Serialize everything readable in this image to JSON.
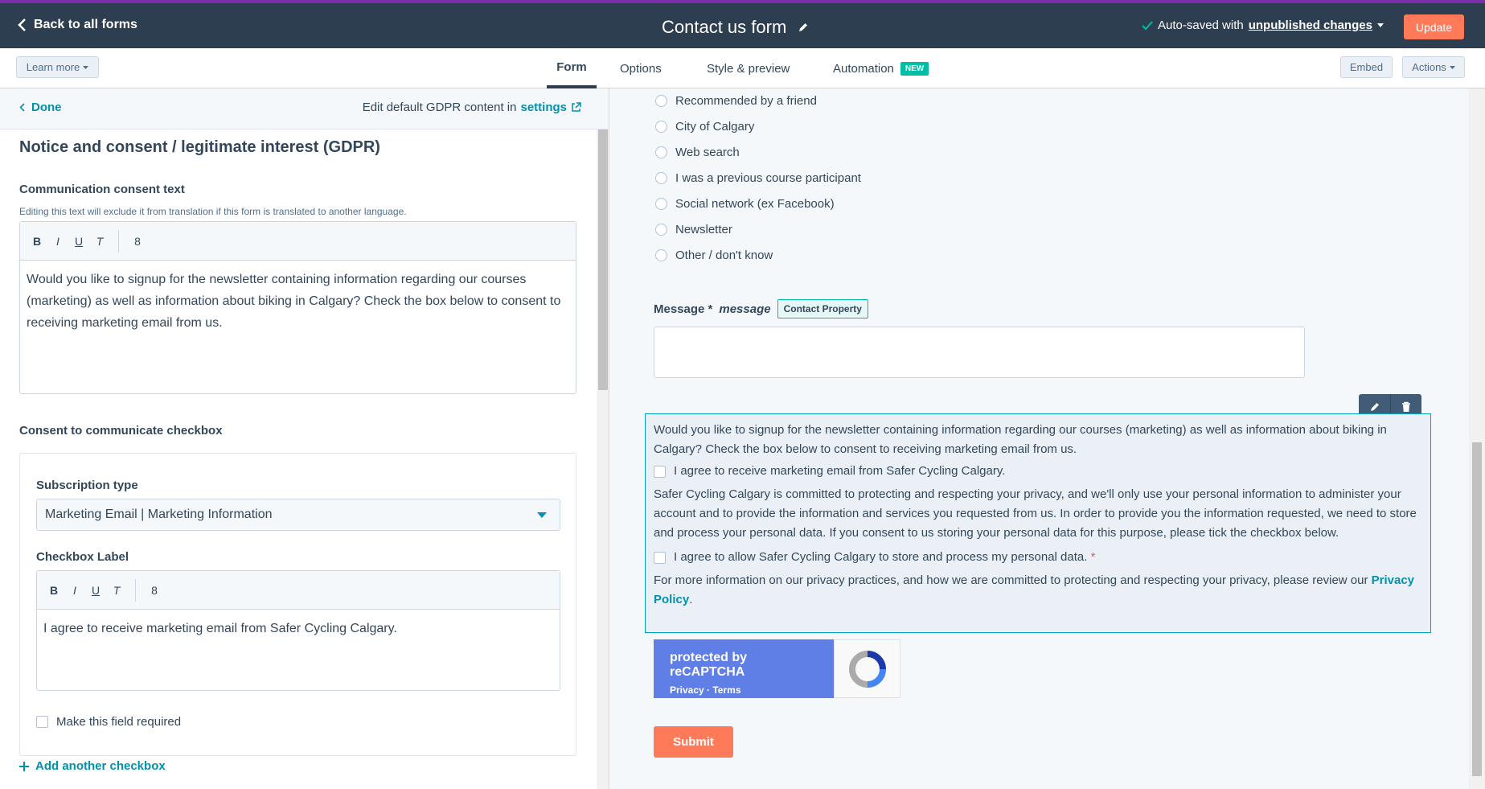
{
  "topbar": {
    "back_label": "Back to all forms",
    "form_title": "Contact us form",
    "autosave_prefix": "Auto-saved with",
    "autosave_link": "unpublished changes",
    "update_label": "Update"
  },
  "navbar": {
    "learn_more": "Learn more",
    "tabs": [
      {
        "label": "Form",
        "active": true
      },
      {
        "label": "Options"
      },
      {
        "label": "Style & preview"
      },
      {
        "label": "Automation",
        "badge": "NEW"
      }
    ],
    "embed": "Embed",
    "actions": "Actions"
  },
  "left": {
    "done": "Done",
    "gdpr_prefix": "Edit default GDPR content in",
    "gdpr_settings": "settings",
    "section_title": "Notice and consent / legitimate interest (GDPR)",
    "consent_text_label": "Communication consent text",
    "consent_hint": "Editing this text will exclude it from translation if this form is translated to another language.",
    "toolbar": {
      "bold": "B",
      "italic": "I",
      "underline": "U",
      "clear": "T",
      "link": "8"
    },
    "consent_text": "Would you like to signup for the newsletter containing information regarding our courses (marketing) as well as information about biking in Calgary? Check the box below to consent to receiving marketing email from us.",
    "checkbox_section_label": "Consent to communicate checkbox",
    "subscription_label": "Subscription type",
    "subscription_value": "Marketing Email | Marketing Information",
    "checkbox_label_title": "Checkbox Label",
    "checkbox_label_text": "I agree to receive marketing email from Safer Cycling Calgary.",
    "required_label": "Make this field required",
    "add_checkbox": "Add another checkbox"
  },
  "right": {
    "radio_options": [
      "Recommended by a friend",
      "City of Calgary",
      "Web search",
      "I was a previous course participant",
      "Social network (ex Facebook)",
      "Newsletter",
      "Other / don't know"
    ],
    "message_label": "Message *",
    "message_property": "message",
    "contact_property_badge": "Contact Property",
    "gdpr_intro": "Would you like to signup for the newsletter containing information regarding our courses (marketing) as well as information about biking in Calgary? Check the box below to consent to receiving marketing email from us.",
    "gdpr_cb1": "I agree to receive marketing email from Safer Cycling Calgary.",
    "gdpr_processing": "Safer Cycling Calgary is committed to protecting and respecting your privacy, and we'll only use your personal information to administer your account and to provide the information and services you requested from us. In order to provide you the information requested, we need to store and process your personal data. If you consent to us storing your personal data for this purpose, please tick the checkbox below.",
    "gdpr_cb2": "I agree to allow Safer Cycling Calgary to store and process my personal data.",
    "gdpr_cb2_star": "*",
    "gdpr_privacy_prefix": "For more information on our privacy practices, and how we are committed to protecting and respecting your privacy, please review our",
    "gdpr_privacy_link": "Privacy Policy",
    "recaptcha_title": "protected by reCAPTCHA",
    "recaptcha_links": "Privacy · Terms",
    "submit_label": "Submit"
  },
  "colors": {
    "topbar": "#2d3e50",
    "accent_orange": "#ff7a59",
    "link_teal": "#0091ae",
    "badge_green": "#00bda5"
  }
}
